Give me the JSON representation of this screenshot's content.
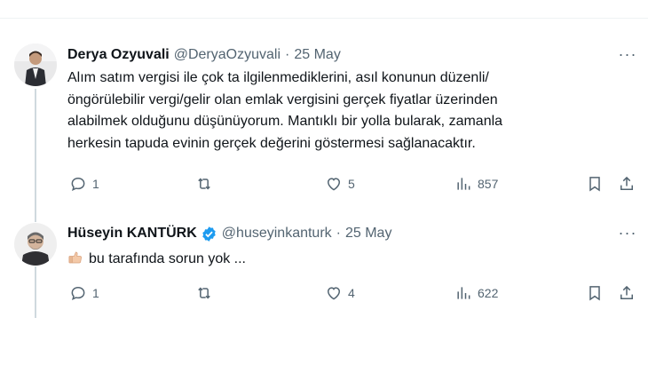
{
  "tweets": [
    {
      "name": "Derya Ozyuvali",
      "handle": "@DeryaOzyuvali",
      "separator": "·",
      "date": "25 May",
      "verified": false,
      "text_lines": [
        "Alım satım vergisi ile çok ta ilgilenmediklerini, asıl konunun düzenli/",
        "öngörülebilir vergi/gelir olan emlak vergisini gerçek fiyatlar üzerinden",
        "alabilmek olduğunu düşünüyorum. Mantıklı bir yolla bularak, zamanla",
        "herkesin tapuda evinin gerçek değerini göstermesi sağlanacaktır."
      ],
      "replies": "1",
      "retweets": "",
      "likes": "5",
      "views": "857"
    },
    {
      "name": "Hüseyin KANTÜRK",
      "handle": "@huseyinkanturk",
      "separator": "·",
      "date": "25 May",
      "verified": true,
      "text_emoji": "thumbs-up-icon",
      "text": "bu tarafında sorun yok ...",
      "replies": "1",
      "retweets": "",
      "likes": "4",
      "views": "622"
    }
  ],
  "more_label": "···",
  "colors": {
    "text": "#0f1419",
    "muted": "#536471",
    "verified": "#1d9bf0",
    "thread_line": "#cfd9de"
  }
}
